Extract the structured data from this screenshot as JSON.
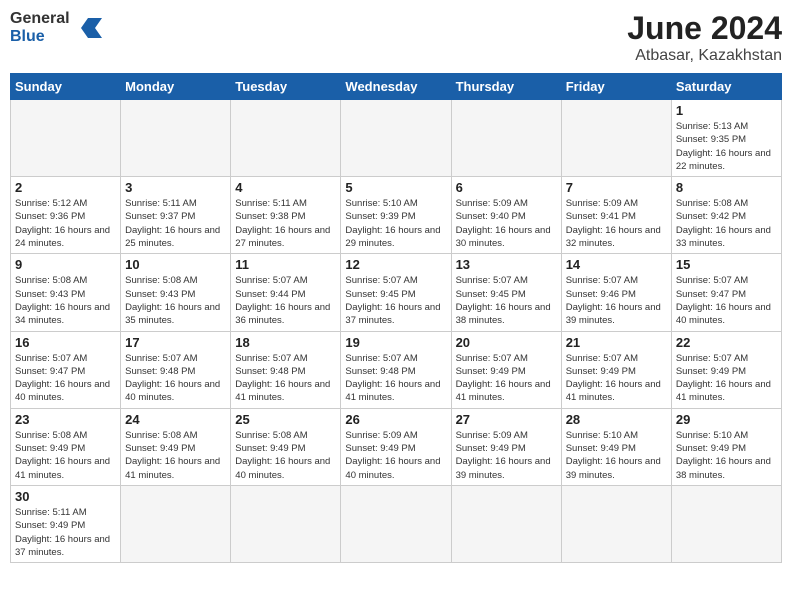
{
  "header": {
    "logo_general": "General",
    "logo_blue": "Blue",
    "month_year": "June 2024",
    "location": "Atbasar, Kazakhstan"
  },
  "days_of_week": [
    "Sunday",
    "Monday",
    "Tuesday",
    "Wednesday",
    "Thursday",
    "Friday",
    "Saturday"
  ],
  "weeks": [
    [
      {
        "day": "",
        "info": "",
        "empty": true
      },
      {
        "day": "",
        "info": "",
        "empty": true
      },
      {
        "day": "",
        "info": "",
        "empty": true
      },
      {
        "day": "",
        "info": "",
        "empty": true
      },
      {
        "day": "",
        "info": "",
        "empty": true
      },
      {
        "day": "",
        "info": "",
        "empty": true
      },
      {
        "day": "1",
        "info": "Sunrise: 5:13 AM\nSunset: 9:35 PM\nDaylight: 16 hours\nand 22 minutes."
      }
    ],
    [
      {
        "day": "2",
        "info": "Sunrise: 5:12 AM\nSunset: 9:36 PM\nDaylight: 16 hours\nand 24 minutes."
      },
      {
        "day": "3",
        "info": "Sunrise: 5:11 AM\nSunset: 9:37 PM\nDaylight: 16 hours\nand 25 minutes."
      },
      {
        "day": "4",
        "info": "Sunrise: 5:11 AM\nSunset: 9:38 PM\nDaylight: 16 hours\nand 27 minutes."
      },
      {
        "day": "5",
        "info": "Sunrise: 5:10 AM\nSunset: 9:39 PM\nDaylight: 16 hours\nand 29 minutes."
      },
      {
        "day": "6",
        "info": "Sunrise: 5:09 AM\nSunset: 9:40 PM\nDaylight: 16 hours\nand 30 minutes."
      },
      {
        "day": "7",
        "info": "Sunrise: 5:09 AM\nSunset: 9:41 PM\nDaylight: 16 hours\nand 32 minutes."
      },
      {
        "day": "8",
        "info": "Sunrise: 5:08 AM\nSunset: 9:42 PM\nDaylight: 16 hours\nand 33 minutes."
      }
    ],
    [
      {
        "day": "9",
        "info": "Sunrise: 5:08 AM\nSunset: 9:43 PM\nDaylight: 16 hours\nand 34 minutes."
      },
      {
        "day": "10",
        "info": "Sunrise: 5:08 AM\nSunset: 9:43 PM\nDaylight: 16 hours\nand 35 minutes."
      },
      {
        "day": "11",
        "info": "Sunrise: 5:07 AM\nSunset: 9:44 PM\nDaylight: 16 hours\nand 36 minutes."
      },
      {
        "day": "12",
        "info": "Sunrise: 5:07 AM\nSunset: 9:45 PM\nDaylight: 16 hours\nand 37 minutes."
      },
      {
        "day": "13",
        "info": "Sunrise: 5:07 AM\nSunset: 9:45 PM\nDaylight: 16 hours\nand 38 minutes."
      },
      {
        "day": "14",
        "info": "Sunrise: 5:07 AM\nSunset: 9:46 PM\nDaylight: 16 hours\nand 39 minutes."
      },
      {
        "day": "15",
        "info": "Sunrise: 5:07 AM\nSunset: 9:47 PM\nDaylight: 16 hours\nand 40 minutes."
      }
    ],
    [
      {
        "day": "16",
        "info": "Sunrise: 5:07 AM\nSunset: 9:47 PM\nDaylight: 16 hours\nand 40 minutes."
      },
      {
        "day": "17",
        "info": "Sunrise: 5:07 AM\nSunset: 9:48 PM\nDaylight: 16 hours\nand 40 minutes."
      },
      {
        "day": "18",
        "info": "Sunrise: 5:07 AM\nSunset: 9:48 PM\nDaylight: 16 hours\nand 41 minutes."
      },
      {
        "day": "19",
        "info": "Sunrise: 5:07 AM\nSunset: 9:48 PM\nDaylight: 16 hours\nand 41 minutes."
      },
      {
        "day": "20",
        "info": "Sunrise: 5:07 AM\nSunset: 9:49 PM\nDaylight: 16 hours\nand 41 minutes."
      },
      {
        "day": "21",
        "info": "Sunrise: 5:07 AM\nSunset: 9:49 PM\nDaylight: 16 hours\nand 41 minutes."
      },
      {
        "day": "22",
        "info": "Sunrise: 5:07 AM\nSunset: 9:49 PM\nDaylight: 16 hours\nand 41 minutes."
      }
    ],
    [
      {
        "day": "23",
        "info": "Sunrise: 5:08 AM\nSunset: 9:49 PM\nDaylight: 16 hours\nand 41 minutes."
      },
      {
        "day": "24",
        "info": "Sunrise: 5:08 AM\nSunset: 9:49 PM\nDaylight: 16 hours\nand 41 minutes."
      },
      {
        "day": "25",
        "info": "Sunrise: 5:08 AM\nSunset: 9:49 PM\nDaylight: 16 hours\nand 40 minutes."
      },
      {
        "day": "26",
        "info": "Sunrise: 5:09 AM\nSunset: 9:49 PM\nDaylight: 16 hours\nand 40 minutes."
      },
      {
        "day": "27",
        "info": "Sunrise: 5:09 AM\nSunset: 9:49 PM\nDaylight: 16 hours\nand 39 minutes."
      },
      {
        "day": "28",
        "info": "Sunrise: 5:10 AM\nSunset: 9:49 PM\nDaylight: 16 hours\nand 39 minutes."
      },
      {
        "day": "29",
        "info": "Sunrise: 5:10 AM\nSunset: 9:49 PM\nDaylight: 16 hours\nand 38 minutes."
      }
    ],
    [
      {
        "day": "30",
        "info": "Sunrise: 5:11 AM\nSunset: 9:49 PM\nDaylight: 16 hours\nand 37 minutes."
      },
      {
        "day": "",
        "info": "",
        "empty": true
      },
      {
        "day": "",
        "info": "",
        "empty": true
      },
      {
        "day": "",
        "info": "",
        "empty": true
      },
      {
        "day": "",
        "info": "",
        "empty": true
      },
      {
        "day": "",
        "info": "",
        "empty": true
      },
      {
        "day": "",
        "info": "",
        "empty": true
      }
    ]
  ]
}
